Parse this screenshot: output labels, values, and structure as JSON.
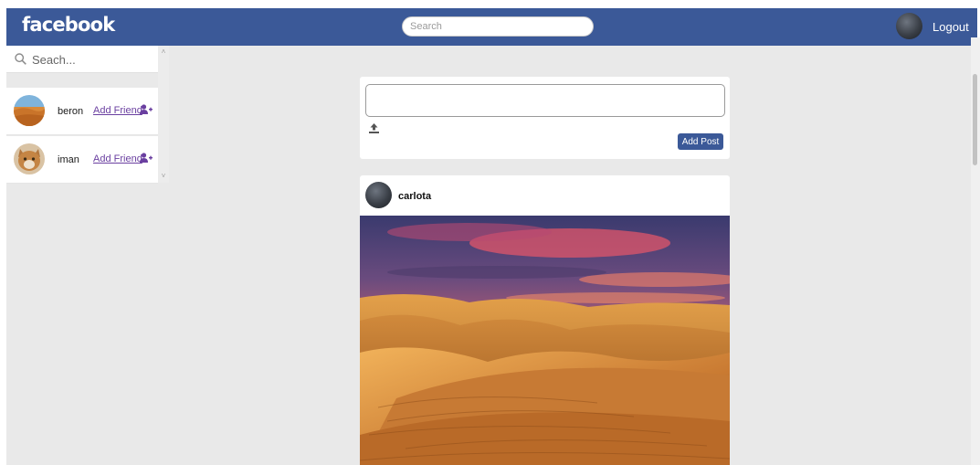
{
  "header": {
    "logo": "facebook",
    "search_placeholder": "Search",
    "logout_label": "Logout"
  },
  "sidebar": {
    "search_placeholder": "Seach...",
    "friends": [
      {
        "name": "beron",
        "action": "Add Friend"
      },
      {
        "name": "iman",
        "action": "Add Friend"
      }
    ]
  },
  "composer": {
    "text_value": "",
    "add_post_label": "Add Post"
  },
  "post": {
    "author": "carlota"
  },
  "colors": {
    "brand": "#3b5998",
    "link": "#6a3fa0",
    "background": "#e9e9e9"
  },
  "icons": [
    "search-icon",
    "add-friend-icon",
    "upload-icon",
    "user-avatar"
  ]
}
